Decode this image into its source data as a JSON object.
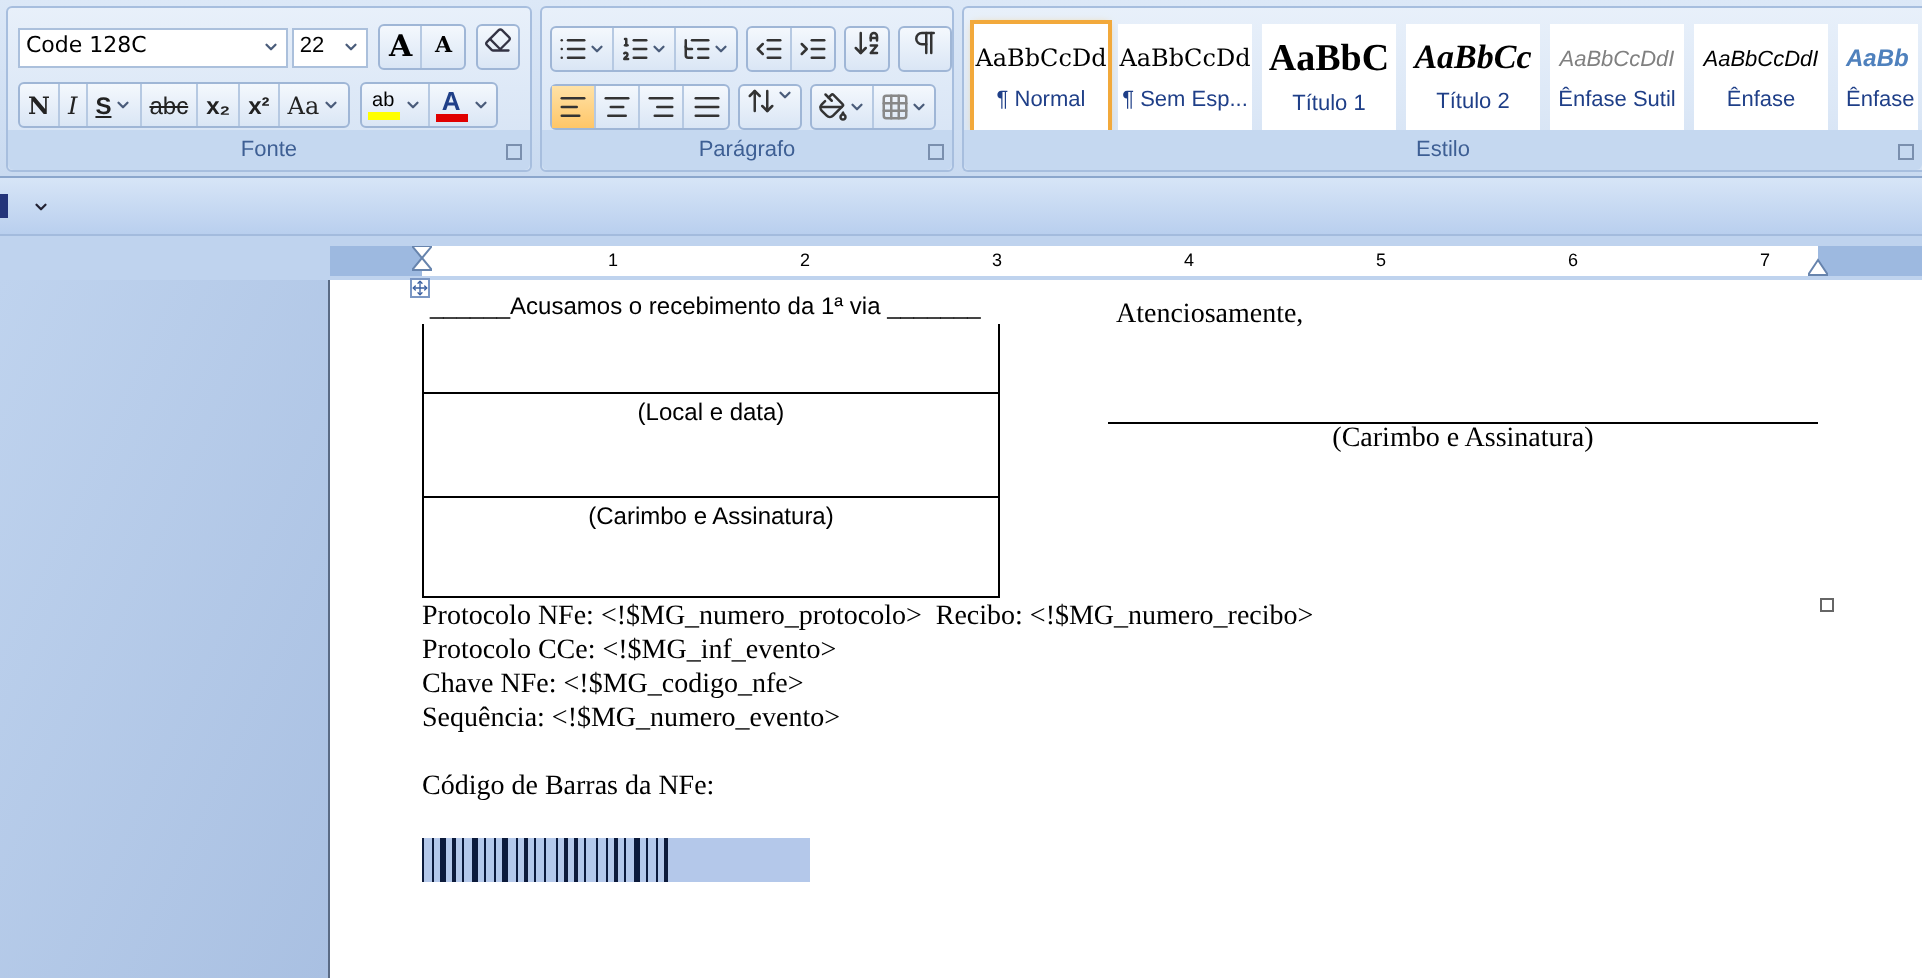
{
  "ribbon": {
    "groups": [
      {
        "kind": "font",
        "label": "Fonte",
        "font_name": "Code 128C",
        "font_size": "22",
        "size_buttons": [
          {
            "label": "A",
            "kind": "grow"
          },
          {
            "label": "A",
            "kind": "shrink"
          }
        ],
        "format_buttons": [
          {
            "label": "N",
            "kind": "bold",
            "dropdown": false
          },
          {
            "label": "I",
            "kind": "italic",
            "dropdown": false
          },
          {
            "label": "S",
            "kind": "underline",
            "dropdown": true
          },
          {
            "label": "abc",
            "kind": "strike",
            "dropdown": false
          },
          {
            "label": "x₂",
            "kind": "sub",
            "dropdown": false
          },
          {
            "label": "x²",
            "kind": "sup",
            "dropdown": false
          },
          {
            "label": "Aa",
            "kind": "case",
            "dropdown": true
          }
        ],
        "highlight": {
          "label": "ab",
          "color": "#ffff00"
        },
        "font_color": {
          "label": "A",
          "color": "#e00000"
        }
      },
      {
        "kind": "paragraph",
        "label": "Parágrafo",
        "alignments": [
          {
            "kind": "left",
            "selected": true
          },
          {
            "kind": "center",
            "selected": false
          },
          {
            "kind": "right",
            "selected": false
          },
          {
            "kind": "justify",
            "selected": false
          }
        ]
      },
      {
        "kind": "styles",
        "label": "Estilo",
        "styles": [
          {
            "preview": "AaBbCcDd",
            "label": "¶ Normal",
            "kind": "normal",
            "selected": true
          },
          {
            "preview": "AaBbCcDd",
            "label": "¶ Sem Esp...",
            "kind": "normal",
            "selected": false
          },
          {
            "preview": "AaBbC",
            "label": "Título 1",
            "kind": "heading1",
            "selected": false
          },
          {
            "preview": "AaBbCc",
            "label": "Título 2",
            "kind": "heading2",
            "selected": false
          },
          {
            "preview": "AaBbCcDdI",
            "label": "Ênfase Sutil",
            "kind": "subtle",
            "selected": false
          },
          {
            "preview": "AaBbCcDdI",
            "label": "Ênfase",
            "kind": "emphasis",
            "selected": false
          },
          {
            "preview": "AaBb",
            "label": "Ênfase",
            "kind": "intense",
            "selected": false
          }
        ]
      }
    ]
  },
  "ruler": {
    "numbers": [
      "1",
      "2",
      "3",
      "4",
      "5",
      "6",
      "7"
    ]
  },
  "document": {
    "receipt": {
      "heading": "______Acusamos o recebimento da 1ª via _______",
      "rows": [
        {},
        {
          "label": "(Local e data)"
        },
        {
          "label": "(Carimbo e Assinatura)"
        }
      ]
    },
    "closing": "Atenciosamente,",
    "signature_label": "(Carimbo e Assinatura)",
    "fields": [
      "Protocolo NFe: <!$MG_numero_protocolo>  Recibo: <!$MG_numero_recibo>",
      "Protocolo CCe: <!$MG_inf_evento>",
      "Chave NFe: <!$MG_codigo_nfe>",
      "Sequência: <!$MG_numero_evento>"
    ],
    "barcode_label": "Código de Barras da NFe:",
    "barcode": {
      "selected": true
    }
  }
}
